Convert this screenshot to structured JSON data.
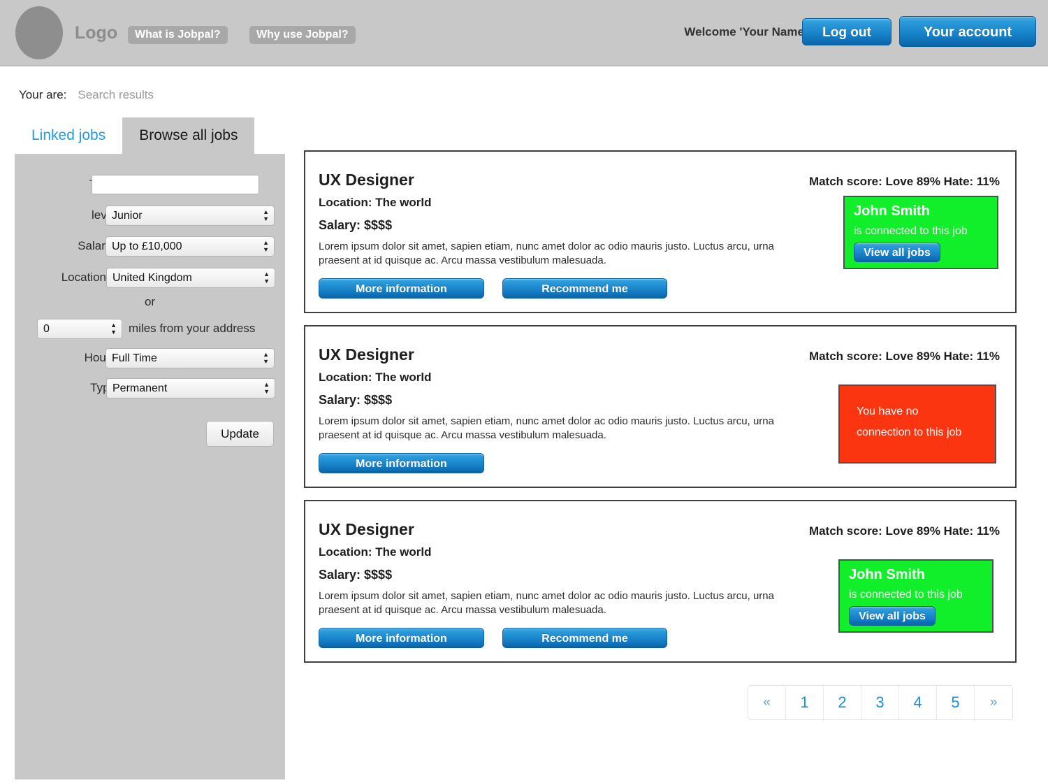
{
  "header": {
    "logo_label": "Logo",
    "nav": [
      {
        "label": "What is Jobpal?"
      },
      {
        "label": "Why use Jobpal?"
      }
    ],
    "welcome": "Welcome 'Your Name'",
    "logout_label": "Log out",
    "account_label": "Your account"
  },
  "breadcrumb": {
    "label": "Your are:",
    "value": "Search results"
  },
  "tabs": [
    {
      "label": "Linked jobs",
      "active": false
    },
    {
      "label": "Browse all jobs",
      "active": true
    }
  ],
  "search_form": {
    "title_label": "Title*",
    "title_value": "",
    "title_placeholder": "",
    "level_label": "level",
    "level_value": "Junior",
    "salary_label": "Salary*",
    "salary_value": "Up to £10,000",
    "location_label": "Location",
    "location_value": "United Kingdom",
    "or_label": "or",
    "miles_value": "0",
    "miles_label": "miles from your address",
    "hours_label": "Hours",
    "hours_value": "Full Time",
    "type_label": "Type",
    "type_value": "Permanent",
    "update_label": "Update"
  },
  "jobs": [
    {
      "title": "UX Designer",
      "match_score": "Match score: Love 89% Hate: 11%",
      "location": "Location: The world",
      "salary": "Salary: $$$$",
      "description": "Lorem ipsum dolor sit amet, sapien etiam, nunc amet dolor ac odio mauris justo. Luctus arcu, urna praesent at id quisque ac. Arcu massa vestibulum malesuada.",
      "more_label": "More information",
      "recommend_label": "Recommend me",
      "has_recommend": true,
      "connection": {
        "state": "connected",
        "color": "#11ef2b",
        "name": "John Smith",
        "subtitle": "is connected to this job",
        "button_label": "View all jobs"
      }
    },
    {
      "title": "UX Designer",
      "match_score": "Match score: Love 89% Hate: 11%",
      "location": "Location: The world",
      "salary": "Salary: $$$$",
      "description": "Lorem ipsum dolor sit amet, sapien etiam, nunc amet dolor ac odio mauris justo. Luctus arcu, urna praesent at id quisque ac. Arcu massa vestibulum malesuada.",
      "more_label": "More information",
      "recommend_label": "Recommend me",
      "has_recommend": false,
      "connection": {
        "state": "none",
        "color": "#fb3510",
        "line1": "You have no",
        "line2": "connection to this job"
      }
    },
    {
      "title": "UX Designer",
      "match_score": "Match score: Love 89% Hate: 11%",
      "location": "Location: The world",
      "salary": "Salary: $$$$",
      "description": "Lorem ipsum dolor sit amet, sapien etiam, nunc amet dolor ac odio mauris justo. Luctus arcu, urna praesent at id quisque ac. Arcu massa vestibulum malesuada.",
      "more_label": "More information",
      "recommend_label": "Recommend me",
      "has_recommend": true,
      "connection": {
        "state": "connected",
        "color": "#11ef2b",
        "name": "John Smith",
        "subtitle": "is connected to this job",
        "button_label": "View all jobs"
      }
    }
  ],
  "pagination": {
    "prev": "«",
    "next": "»",
    "pages": [
      "1",
      "2",
      "3",
      "4",
      "5"
    ]
  },
  "colors": {
    "accent_blue": "#1b8fe0",
    "header_gray": "#c8c8c8",
    "connected_green": "#11ef2b",
    "no_connection_red": "#fb3510"
  }
}
